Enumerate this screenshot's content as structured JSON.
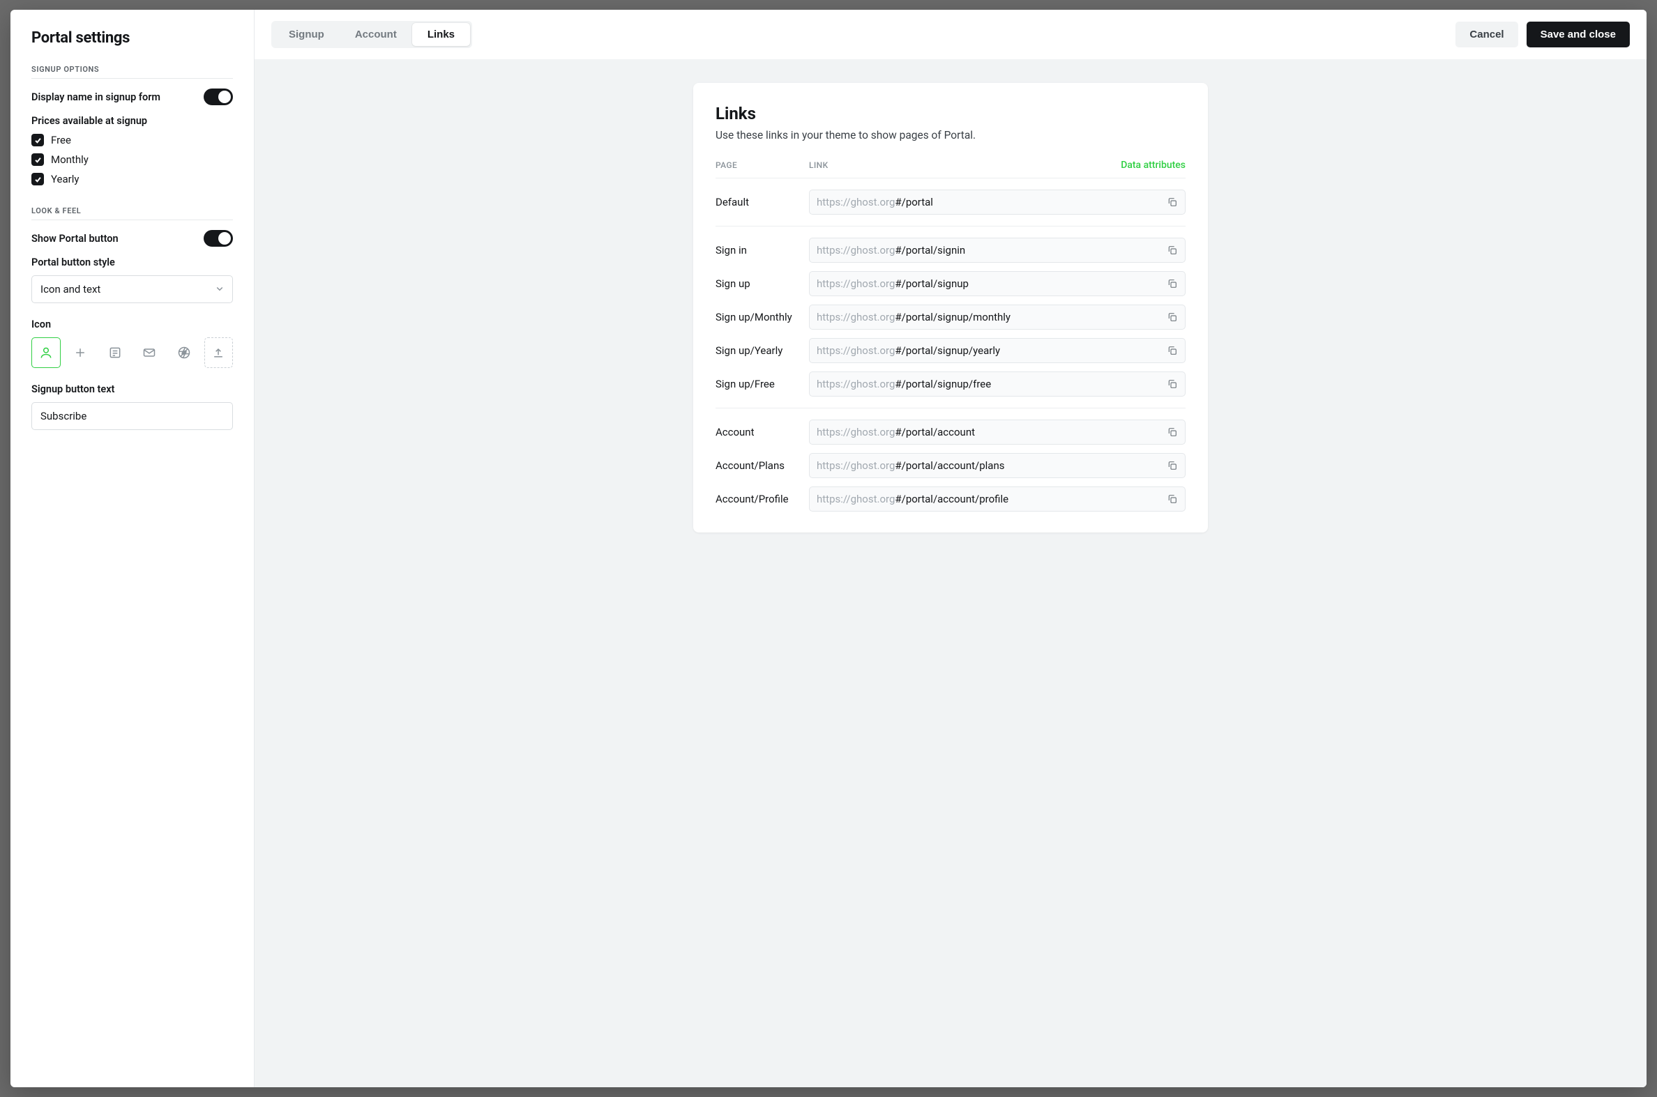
{
  "sidebar": {
    "title": "Portal settings",
    "signup_section": "Signup options",
    "display_name_label": "Display name in signup form",
    "prices_label": "Prices available at signup",
    "prices": [
      "Free",
      "Monthly",
      "Yearly"
    ],
    "look_section": "Look & feel",
    "show_button_label": "Show Portal button",
    "button_style_label": "Portal button style",
    "button_style_value": "Icon and text",
    "icon_label": "Icon",
    "signup_text_label": "Signup button text",
    "signup_text_value": "Subscribe"
  },
  "topbar": {
    "tabs": [
      "Signup",
      "Account",
      "Links"
    ],
    "active_tab": "Links",
    "cancel": "Cancel",
    "save": "Save and close"
  },
  "links": {
    "title": "Links",
    "subtitle": "Use these links in your theme to show pages of Portal.",
    "col_page": "Page",
    "col_link": "Link",
    "data_attr": "Data attributes",
    "host": "https://ghost.org",
    "groups": [
      [
        {
          "page": "Default",
          "path": "#/portal"
        }
      ],
      [
        {
          "page": "Sign in",
          "path": "#/portal/signin"
        },
        {
          "page": "Sign up",
          "path": "#/portal/signup"
        },
        {
          "page": "Sign up/Monthly",
          "path": "#/portal/signup/monthly"
        },
        {
          "page": "Sign up/Yearly",
          "path": "#/portal/signup/yearly"
        },
        {
          "page": "Sign up/Free",
          "path": "#/portal/signup/free"
        }
      ],
      [
        {
          "page": "Account",
          "path": "#/portal/account"
        },
        {
          "page": "Account/Plans",
          "path": "#/portal/account/plans"
        },
        {
          "page": "Account/Profile",
          "path": "#/portal/account/profile"
        }
      ]
    ]
  }
}
